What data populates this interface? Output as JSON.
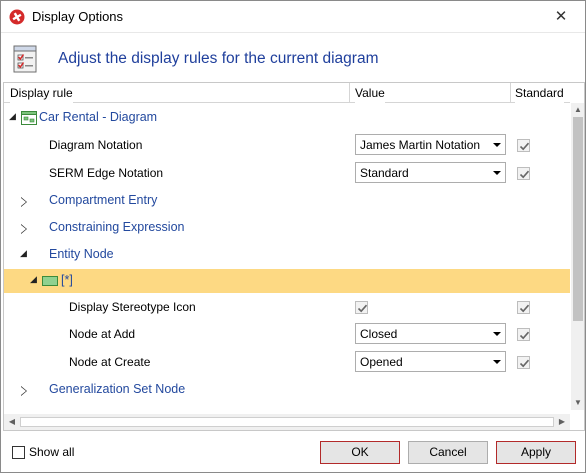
{
  "window": {
    "title": "Display Options"
  },
  "header": {
    "text": "Adjust the display rules for the current diagram"
  },
  "columns": {
    "rule": "Display rule",
    "value": "Value",
    "standard": "Standard"
  },
  "rows": [
    {
      "label": "Car Rental - Diagram",
      "kind": "root"
    },
    {
      "label": "Diagram Notation",
      "value": "James Martin Notation",
      "standard": true
    },
    {
      "label": "SERM Edge Notation",
      "value": "Standard",
      "standard": true
    },
    {
      "label": "Compartment Entry",
      "kind": "group-collapsed"
    },
    {
      "label": "Constraining Expression",
      "kind": "group-collapsed"
    },
    {
      "label": "Entity Node",
      "kind": "group-expanded"
    },
    {
      "label": "[*]",
      "kind": "selected"
    },
    {
      "label": "Display Stereotype Icon",
      "checked": true,
      "standard": true
    },
    {
      "label": "Node at Add",
      "value": "Closed",
      "standard": true
    },
    {
      "label": "Node at Create",
      "value": "Opened",
      "standard": true
    },
    {
      "label": "Generalization Set Node",
      "kind": "group-collapsed"
    }
  ],
  "scroll": {
    "up_glyph": "▲",
    "down_glyph": "▼",
    "left_glyph": "◀",
    "right_glyph": "▶"
  },
  "footer": {
    "show_all_label": "Show all",
    "ok_label": "OK",
    "cancel_label": "Cancel",
    "apply_label": "Apply"
  },
  "colors": {
    "accent_text": "#23499e",
    "selection": "#fdd983",
    "default_button_border": "#b22a2a"
  },
  "icons": {
    "app": "red-plus-circle-icon",
    "close": "close-icon",
    "header": "checklist-icon",
    "diagram": "diagram-icon",
    "node": "green-rectangle-icon"
  }
}
